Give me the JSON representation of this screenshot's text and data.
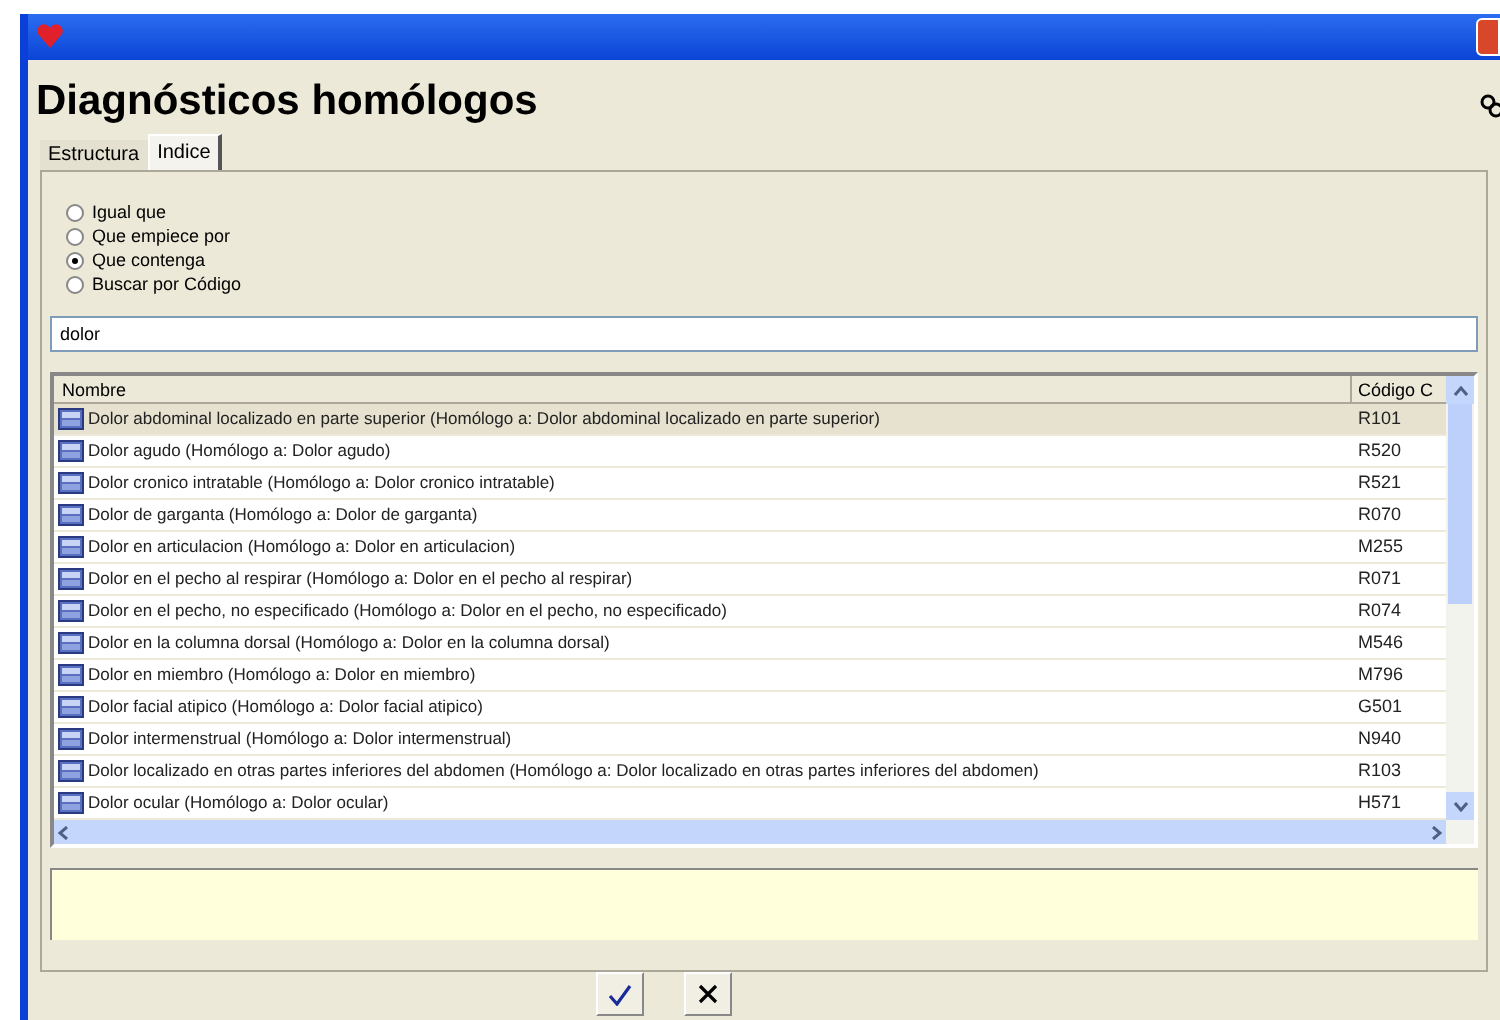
{
  "window": {
    "title": "Diagnósticos homólogos"
  },
  "tabs": [
    {
      "label": "Estructura",
      "selected": false
    },
    {
      "label": "Indice",
      "selected": true
    }
  ],
  "search_modes": [
    {
      "label": "Igual que",
      "selected": false
    },
    {
      "label": "Que empiece por",
      "selected": false
    },
    {
      "label": "Que contenga",
      "selected": true
    },
    {
      "label": "Buscar por Código",
      "selected": false
    }
  ],
  "search": {
    "value": "dolor"
  },
  "table": {
    "columns": [
      "Nombre",
      "Código C"
    ],
    "rows": [
      {
        "name": "Dolor abdominal localizado en parte superior (Homólogo a: Dolor abdominal localizado en parte superior)",
        "code": "R101",
        "selected": true
      },
      {
        "name": "Dolor agudo (Homólogo a: Dolor agudo)",
        "code": "R520",
        "selected": false
      },
      {
        "name": "Dolor cronico intratable (Homólogo a: Dolor cronico intratable)",
        "code": "R521",
        "selected": false
      },
      {
        "name": "Dolor de garganta (Homólogo a: Dolor de garganta)",
        "code": "R070",
        "selected": false
      },
      {
        "name": "Dolor en articulacion (Homólogo a: Dolor en articulacion)",
        "code": "M255",
        "selected": false
      },
      {
        "name": "Dolor en el pecho al respirar (Homólogo a: Dolor en el pecho al respirar)",
        "code": "R071",
        "selected": false
      },
      {
        "name": "Dolor en el pecho, no especificado (Homólogo a: Dolor en el pecho, no especificado)",
        "code": "R074",
        "selected": false
      },
      {
        "name": "Dolor en la columna dorsal (Homólogo a: Dolor en la columna dorsal)",
        "code": "M546",
        "selected": false
      },
      {
        "name": "Dolor en miembro (Homólogo a: Dolor en miembro)",
        "code": "M796",
        "selected": false
      },
      {
        "name": "Dolor facial atipico (Homólogo a: Dolor facial atipico)",
        "code": "G501",
        "selected": false
      },
      {
        "name": "Dolor intermenstrual (Homólogo a: Dolor intermenstrual)",
        "code": "N940",
        "selected": false
      },
      {
        "name": "Dolor localizado en otras partes inferiores del abdomen (Homólogo a: Dolor localizado en otras partes inferiores del abdomen)",
        "code": "R103",
        "selected": false
      },
      {
        "name": "Dolor ocular (Homólogo a: Dolor ocular)",
        "code": "H571",
        "selected": false
      }
    ]
  },
  "buttons": [
    {
      "kind": "accept"
    },
    {
      "kind": "cancel"
    }
  ]
}
